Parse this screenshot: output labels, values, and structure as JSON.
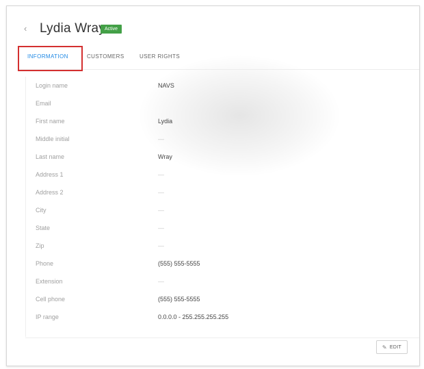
{
  "header": {
    "back_icon": "chevron-left-icon",
    "title": "Lydia Wray",
    "status": "Active",
    "status_color": "#43a047"
  },
  "tabs": [
    {
      "label": "INFORMATION",
      "active": true
    },
    {
      "label": "CUSTOMERS",
      "active": false
    },
    {
      "label": "USER RIGHTS",
      "active": false
    }
  ],
  "accent_color": "#1e88e5",
  "highlight_color": "#d32f2f",
  "fields": [
    {
      "label": "Login name",
      "value": "NAVS"
    },
    {
      "label": "Email",
      "value": ""
    },
    {
      "label": "First name",
      "value": "Lydia"
    },
    {
      "label": "Middle initial",
      "value": "—"
    },
    {
      "label": "Last name",
      "value": "Wray"
    },
    {
      "label": "Address 1",
      "value": "—"
    },
    {
      "label": "Address 2",
      "value": "—"
    },
    {
      "label": "City",
      "value": "—"
    },
    {
      "label": "State",
      "value": "—"
    },
    {
      "label": "Zip",
      "value": "—"
    },
    {
      "label": "Phone",
      "value": "(555) 555-5555"
    },
    {
      "label": "Extension",
      "value": "—"
    },
    {
      "label": "Cell phone",
      "value": "(555) 555-5555"
    },
    {
      "label": "IP range",
      "value": "0.0.0.0 - 255.255.255.255"
    }
  ],
  "actions": {
    "edit_label": "EDIT",
    "edit_icon": "pencil-icon"
  }
}
